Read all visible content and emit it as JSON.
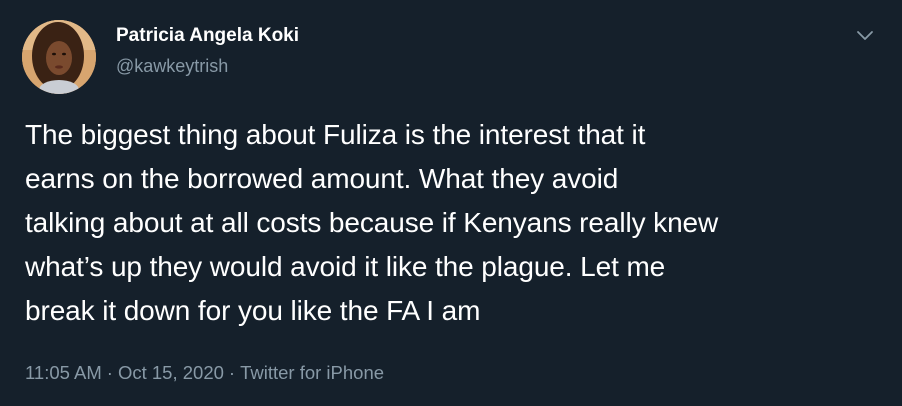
{
  "author": {
    "name": "Patricia Angela Koki",
    "handle": "@kawkeytrish",
    "avatar_icon": "user-avatar-photo"
  },
  "tweet": {
    "lines": [
      "The biggest thing about Fuliza is the interest that it",
      "earns on the borrowed amount. What they avoid",
      "talking about at all costs because if Kenyans really knew",
      "what’s up they would avoid it like the plague. Let me",
      "break it down for you like the FA I am"
    ]
  },
  "meta": {
    "time": "11:05 AM",
    "separator": "·",
    "date": "Oct 15, 2020",
    "source": "Twitter for iPhone"
  },
  "menu": {
    "icon": "chevron-down-icon"
  },
  "colors": {
    "background": "#15202b",
    "text_primary": "#ffffff",
    "text_secondary": "#8899a6"
  }
}
